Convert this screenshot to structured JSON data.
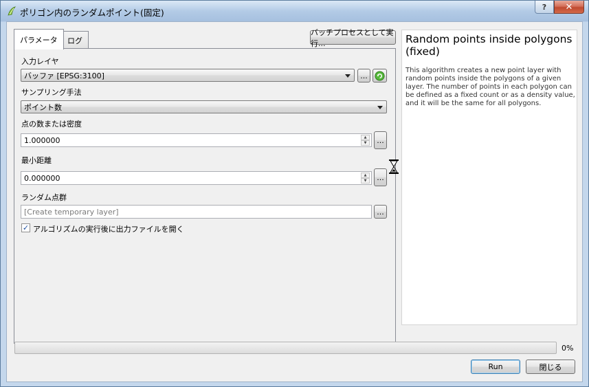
{
  "window": {
    "title": "ポリゴン内のランダムポイント(固定)",
    "help_button": "?",
    "close_button": "✕"
  },
  "tabs": [
    {
      "label": "パラメータ",
      "active": true
    },
    {
      "label": "ログ",
      "active": false
    }
  ],
  "batch_button": "バッチプロセスとして実行...",
  "params": {
    "input_layer": {
      "label": "入力レイヤ",
      "value": "バッファ [EPSG:3100]",
      "browse": "..."
    },
    "sampling": {
      "label": "サンプリング手法",
      "value": "ポイント数"
    },
    "points": {
      "label": "点の数または密度",
      "value": "1.000000",
      "browse": "..."
    },
    "min_distance": {
      "label": "最小距離",
      "value": "0.000000",
      "browse": "..."
    },
    "output": {
      "label": "ランダム点群",
      "placeholder": "[Create temporary layer]",
      "browse": "..."
    },
    "open_after": {
      "label": "アルゴリズムの実行後に出力ファイルを開く",
      "checked": true
    }
  },
  "help": {
    "title": "Random points inside polygons (fixed)",
    "body": "This algorithm creates a new point layer with random points inside the polygons of a given layer. The number of points in each polygon can be defined as a fixed count or as a density value, and it will be the same for all polygons."
  },
  "progress": {
    "value": 0,
    "label": "0%"
  },
  "buttons": {
    "run": "Run",
    "close": "閉じる"
  },
  "colors": {
    "progress_fill": "#38c33f",
    "run_focus": "#3c7fb1"
  }
}
